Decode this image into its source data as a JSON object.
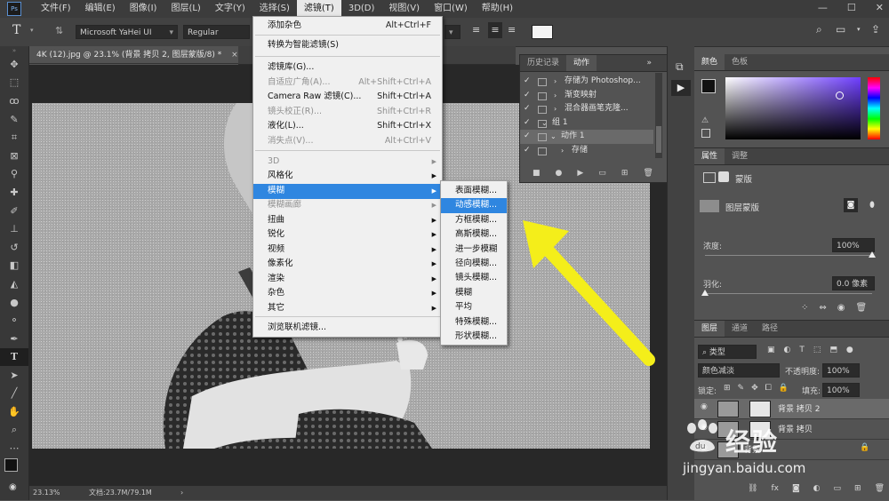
{
  "menubar": {
    "items": [
      "文件(F)",
      "编辑(E)",
      "图像(I)",
      "图层(L)",
      "文字(Y)",
      "选择(S)",
      "滤镜(T)",
      "3D(D)",
      "视图(V)",
      "窗口(W)",
      "帮助(H)"
    ],
    "active_index": 6
  },
  "options": {
    "font_family": "Microsoft YaHei UI",
    "font_style": "Regular"
  },
  "document": {
    "tab_title": "4K (12).jpg @ 23.1% (背景 拷贝 2, 图层蒙版/8) *",
    "close": "×"
  },
  "status": {
    "zoom": "23.13%",
    "doc_info": "文档:23.7M/79.1M",
    "more": "›"
  },
  "filter_menu": {
    "items": [
      {
        "label": "添加杂色",
        "shortcut": "Alt+Ctrl+F"
      },
      {
        "label": "转换为智能滤镜(S)",
        "shortcut": ""
      },
      {
        "label": "滤镜库(G)...",
        "shortcut": ""
      },
      {
        "label": "自适应广角(A)...",
        "shortcut": "Alt+Shift+Ctrl+A",
        "disabled": true
      },
      {
        "label": "Camera Raw 滤镜(C)...",
        "shortcut": "Shift+Ctrl+A"
      },
      {
        "label": "镜头校正(R)...",
        "shortcut": "Shift+Ctrl+R",
        "disabled": true
      },
      {
        "label": "液化(L)...",
        "shortcut": "Shift+Ctrl+X"
      },
      {
        "label": "消失点(V)...",
        "shortcut": "Alt+Ctrl+V",
        "disabled": true
      },
      {
        "label": "3D",
        "disabled": true
      },
      {
        "label": "风格化"
      },
      {
        "label": "模糊",
        "highlight": true
      },
      {
        "label": "模糊画廊",
        "disabled": true
      },
      {
        "label": "扭曲"
      },
      {
        "label": "锐化"
      },
      {
        "label": "视频"
      },
      {
        "label": "像素化"
      },
      {
        "label": "渲染"
      },
      {
        "label": "杂色"
      },
      {
        "label": "其它"
      },
      {
        "label": "浏览联机滤镜..."
      }
    ]
  },
  "blur_submenu": {
    "items": [
      "表面模糊...",
      "动感模糊...",
      "方框模糊...",
      "高斯模糊...",
      "进一步模糊",
      "径向模糊...",
      "镜头模糊...",
      "模糊",
      "平均",
      "特殊模糊...",
      "形状模糊..."
    ],
    "highlight_index": 1
  },
  "actions_panel": {
    "tabs": [
      "历史记录",
      "动作"
    ],
    "active_tab": 1,
    "menu_glyph": "≡",
    "expand_glyph": "»",
    "rows": [
      {
        "label": "存储为 Photoshop..."
      },
      {
        "label": "渐变映射"
      },
      {
        "label": "混合器画笔克隆..."
      },
      {
        "label": "组 1"
      },
      {
        "label": "动作 1"
      },
      {
        "label": "存储"
      }
    ]
  },
  "color_panel": {
    "tabs": [
      "颜色",
      "色板"
    ],
    "active_tab": 0
  },
  "properties_panel": {
    "tabs": [
      "属性",
      "调整"
    ],
    "active_tab": 0,
    "heading": "蒙版",
    "sub": "图层蒙版",
    "density_label": "浓度:",
    "density_value": "100%",
    "feather_label": "羽化:",
    "feather_value": "0.0 像素",
    "density_fraction": 1.0,
    "feather_fraction": 0.0
  },
  "layers_panel": {
    "tabs": [
      "图层",
      "通道",
      "路径"
    ],
    "active_tab": 0,
    "kind_filter": "类型",
    "blend_mode": "颜色减淡",
    "opacity_label": "不透明度:",
    "opacity_value": "100%",
    "lock_label": "锁定:",
    "fill_label": "填充:",
    "fill_value": "100%",
    "layers": [
      {
        "name": "背景 拷贝 2"
      },
      {
        "name": "背景 拷贝"
      },
      {
        "name": "背景"
      }
    ],
    "footer_fx": "fx"
  },
  "watermark": {
    "brand": "经验",
    "url": "jingyan.baidu.com"
  },
  "colors": {
    "highlight": "#2f86e0",
    "arrow": "#f4ee1a",
    "panel_bg": "#535353"
  }
}
